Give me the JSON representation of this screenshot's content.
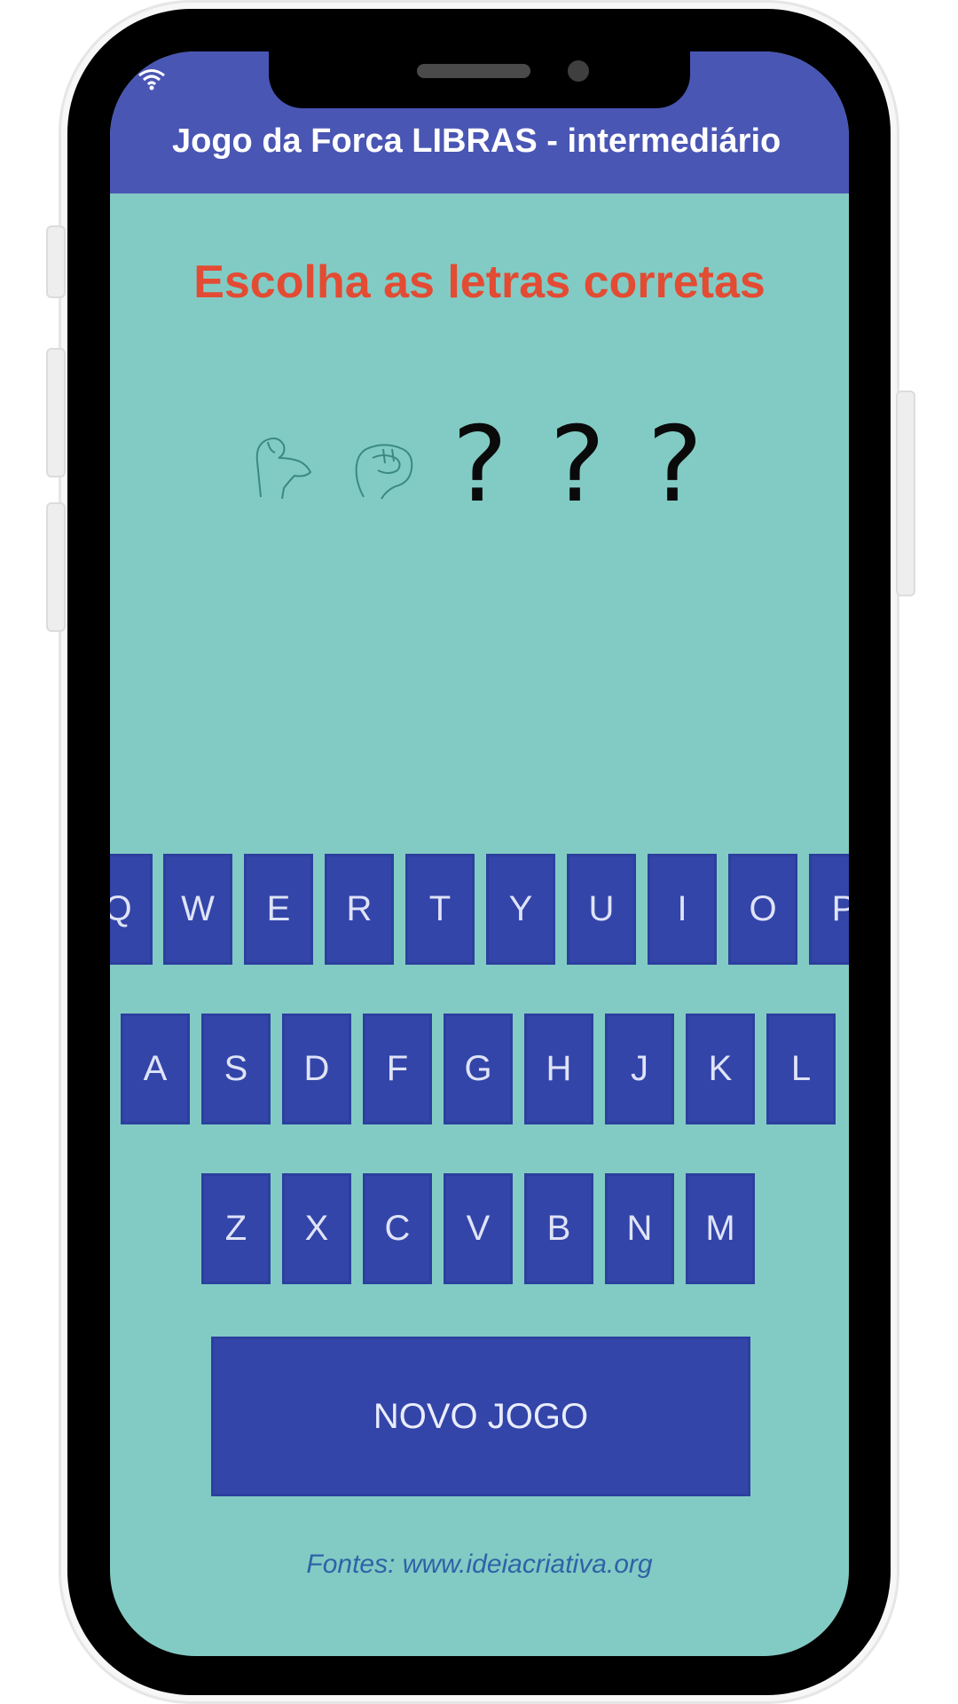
{
  "app": {
    "title": "Jogo da Forca LIBRAS - intermediário"
  },
  "game": {
    "instruction": "Escolha as letras corretas",
    "revealed_signs": [
      "hand-sign-icon",
      "hand-sign-icon"
    ],
    "hidden": [
      "?",
      "?",
      "?"
    ]
  },
  "keyboard": {
    "row1": [
      "Q",
      "W",
      "E",
      "R",
      "T",
      "Y",
      "U",
      "I",
      "O",
      "P"
    ],
    "row2": [
      "A",
      "S",
      "D",
      "F",
      "G",
      "H",
      "J",
      "K",
      "L"
    ],
    "row3": [
      "Z",
      "X",
      "C",
      "V",
      "B",
      "N",
      "M"
    ]
  },
  "actions": {
    "new_game": "NOVO JOGO"
  },
  "footer": {
    "credits": "Fontes: www.ideiacriativa.org"
  },
  "colors": {
    "appbar": "#4a56b4",
    "background": "#82cbc4",
    "key": "#3345a8",
    "instruction": "#e34b33",
    "credits": "#2f62a8"
  }
}
